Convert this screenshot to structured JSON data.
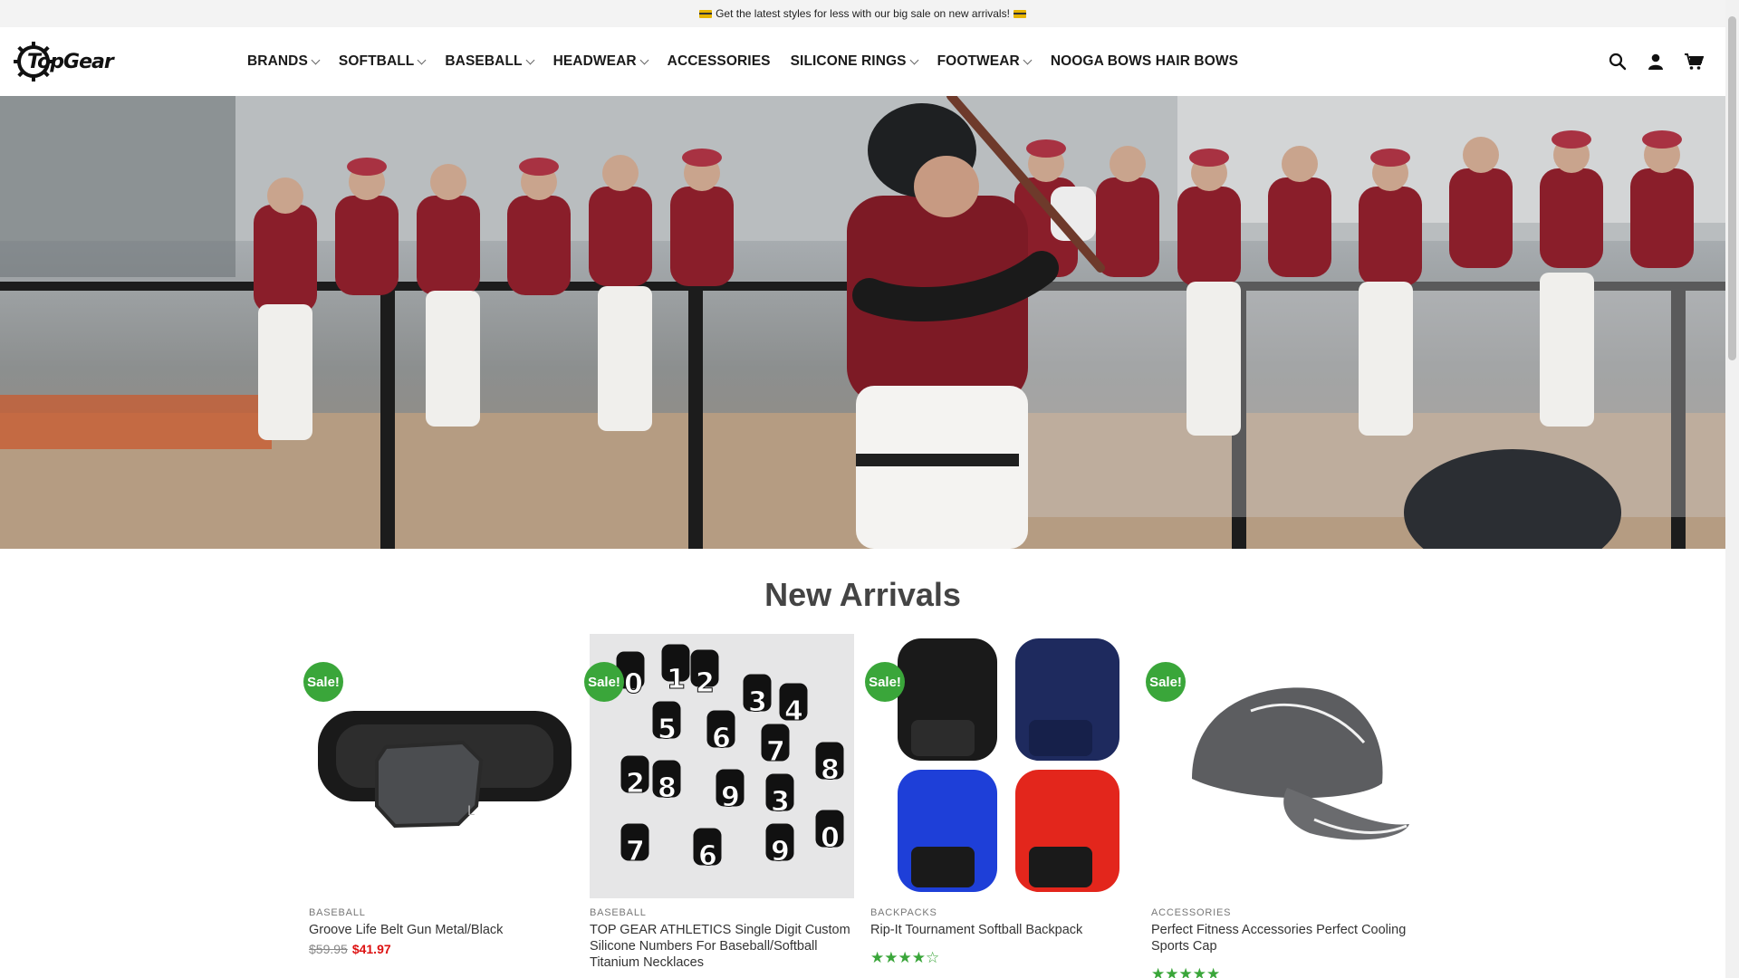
{
  "announcement": {
    "text": "Get the latest styles for less with our big sale on new arrivals!"
  },
  "brand": {
    "name": "TopGear"
  },
  "nav": {
    "items": [
      {
        "label": "BRANDS",
        "dropdown": true
      },
      {
        "label": "SOFTBALL",
        "dropdown": true
      },
      {
        "label": "BASEBALL",
        "dropdown": true
      },
      {
        "label": "HEADWEAR",
        "dropdown": true
      },
      {
        "label": "ACCESSORIES",
        "dropdown": false
      },
      {
        "label": "SILICONE RINGS",
        "dropdown": true
      },
      {
        "label": "FOOTWEAR",
        "dropdown": true
      },
      {
        "label": "NOOGA BOWS HAIR BOWS",
        "dropdown": false
      }
    ],
    "icons": [
      "search-icon",
      "account-icon",
      "cart-icon"
    ]
  },
  "section": {
    "title": "New Arrivals"
  },
  "products": [
    {
      "badge": "Sale!",
      "category": "BASEBALL",
      "name": "Groove Life Belt Gun Metal/Black",
      "old_price": "$59.95",
      "price": "$41.97",
      "rating": null
    },
    {
      "badge": "Sale!",
      "category": "BASEBALL",
      "name": "TOP GEAR ATHLETICS Single Digit Custom Silicone Numbers For Baseball/Softball Titanium Necklaces",
      "old_price": "",
      "price": "",
      "rating": null
    },
    {
      "badge": "Sale!",
      "category": "BACKPACKS",
      "name": "Rip-It Tournament Softball Backpack",
      "old_price": "",
      "price": "",
      "rating": 4
    },
    {
      "badge": "Sale!",
      "category": "ACCESSORIES",
      "name": "Perfect Fitness Accessories Perfect Cooling Sports Cap",
      "old_price": "",
      "price": "",
      "rating": 5
    }
  ],
  "colors": {
    "sale_badge": "#3aa63a",
    "price_sale": "#dd1111",
    "hero_jersey": "#8a1e2a"
  }
}
